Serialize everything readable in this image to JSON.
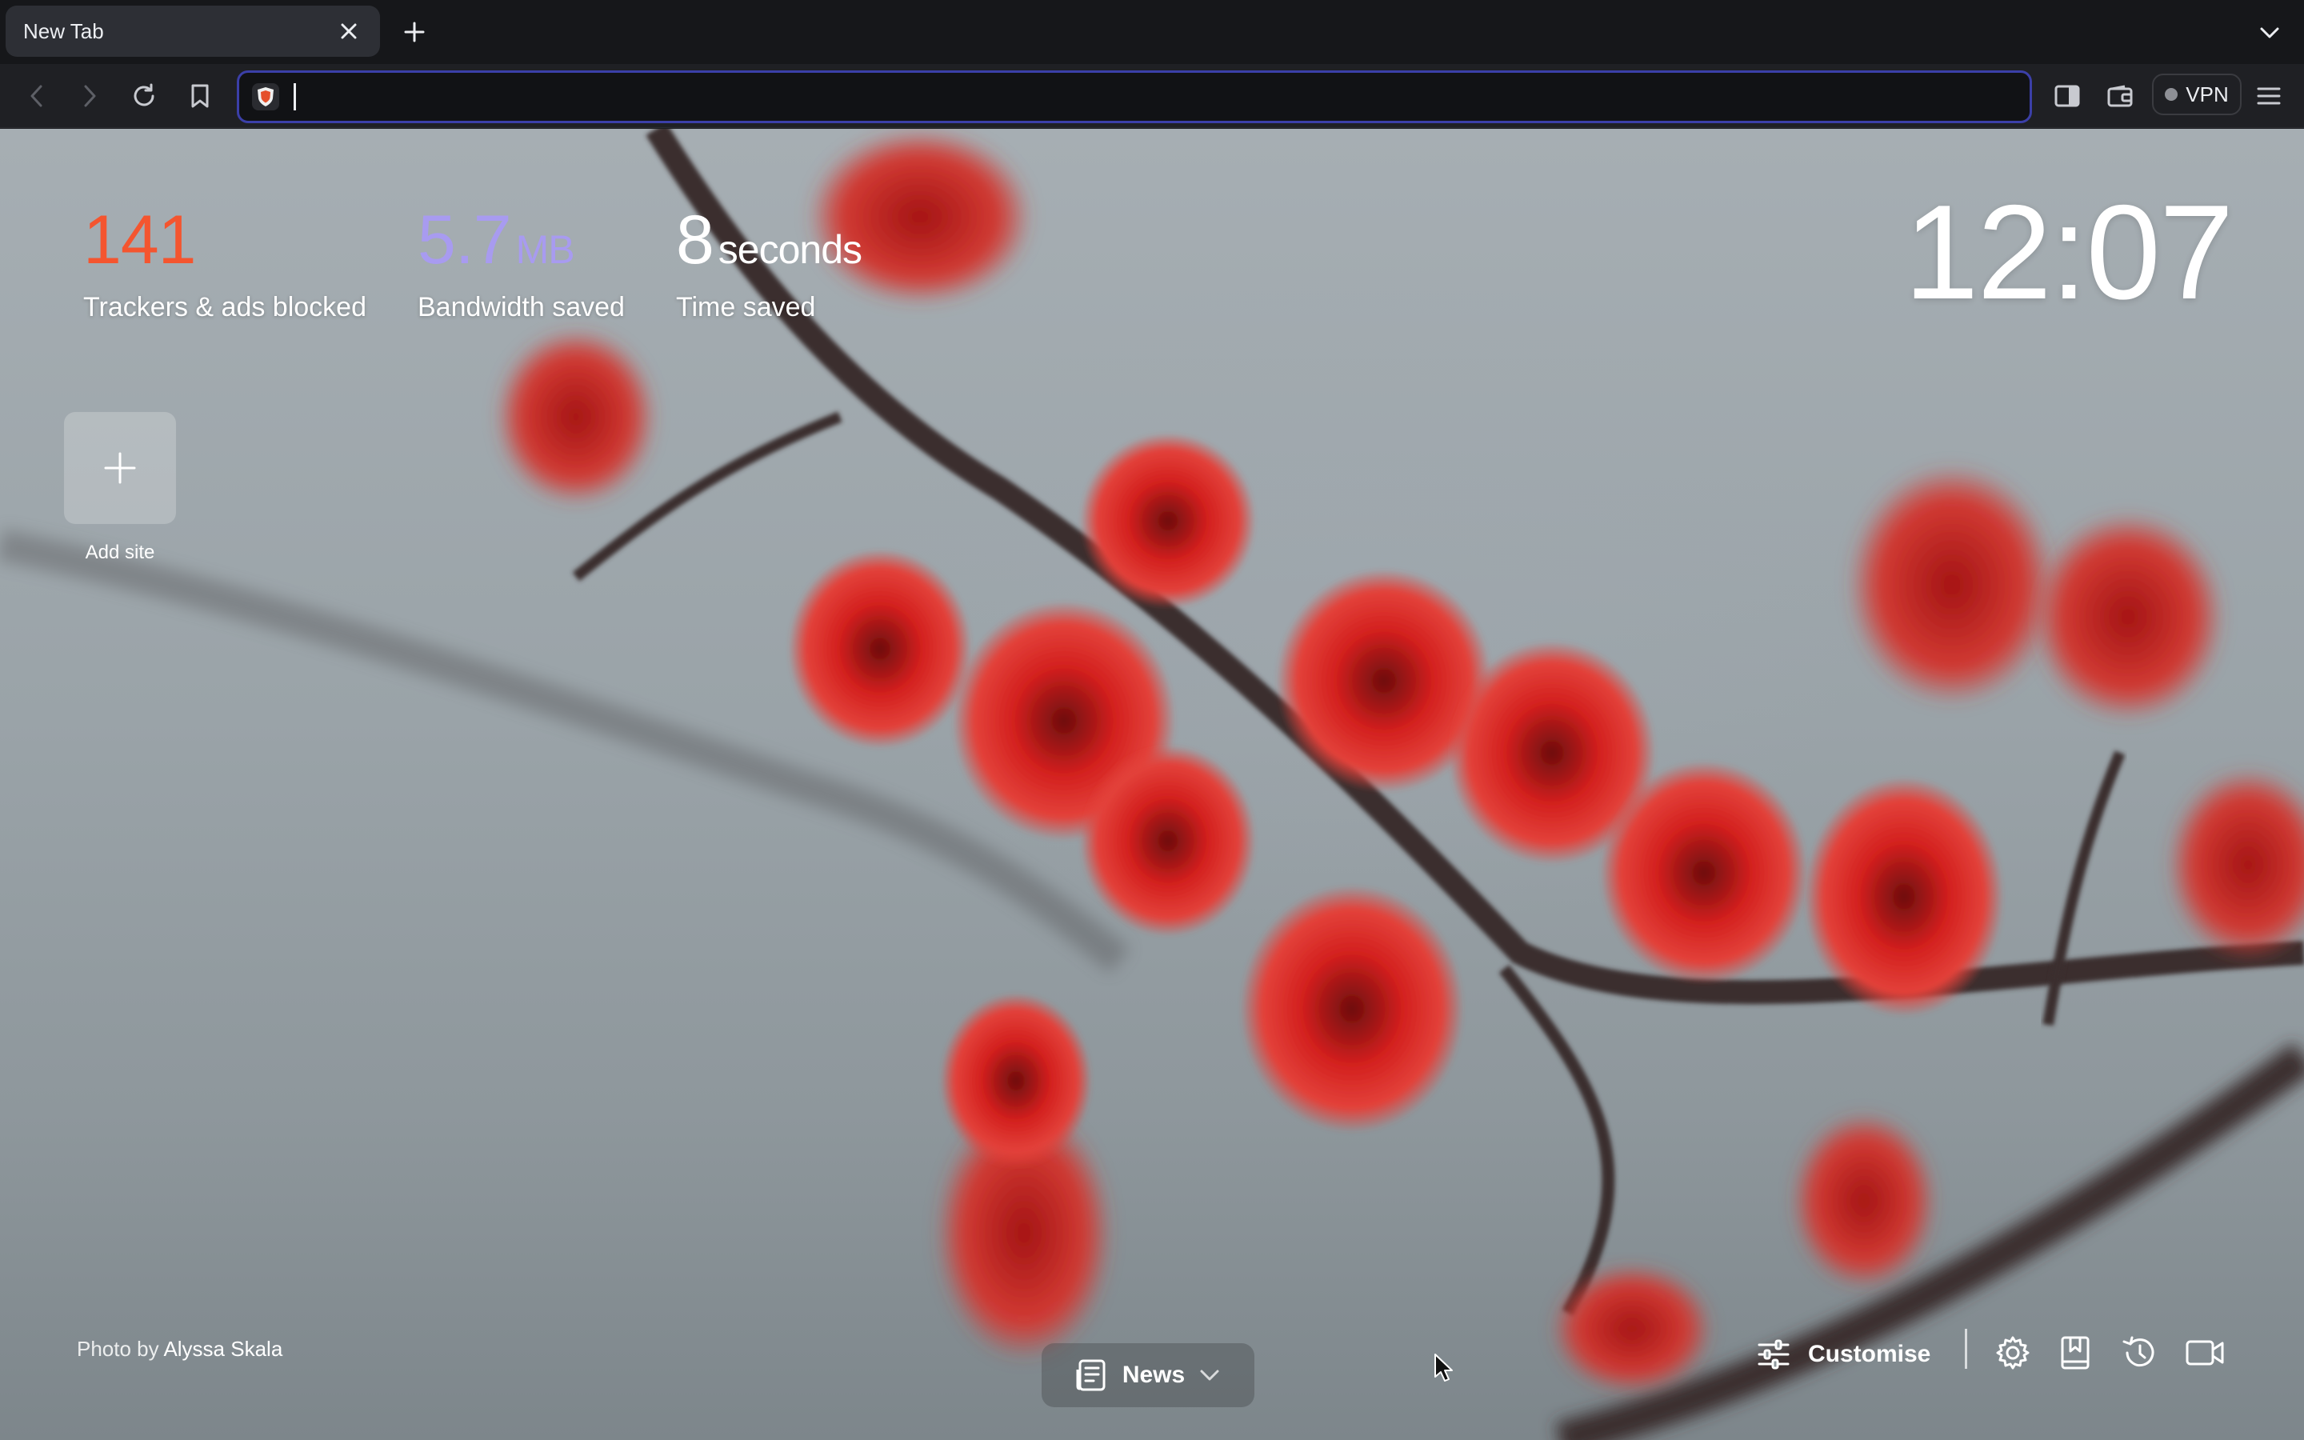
{
  "tab": {
    "title": "New Tab"
  },
  "toolbar": {
    "address_value": "",
    "vpn_label": "VPN"
  },
  "stats": {
    "trackers": {
      "value": "141",
      "label": "Trackers & ads blocked",
      "color": "#f4552f"
    },
    "bandwidth": {
      "value": "5.7",
      "unit": "MB",
      "label": "Bandwidth saved",
      "color": "#a89bf0"
    },
    "time": {
      "value": "8",
      "unit": "seconds",
      "label": "Time saved",
      "color": "#ffffff"
    }
  },
  "clock": {
    "time": "12:07"
  },
  "top_sites": {
    "add_label": "Add site"
  },
  "photo_credit": {
    "prefix": "Photo by",
    "author": "Alyssa Skala"
  },
  "news": {
    "label": "News"
  },
  "customise": {
    "label": "Customise"
  },
  "icons": [
    "close-icon",
    "plus-icon",
    "chevron-down-icon",
    "back-icon",
    "forward-icon",
    "reload-icon",
    "bookmark-icon",
    "brave-shield-icon",
    "sidebar-icon",
    "wallet-icon",
    "menu-icon",
    "news-icon",
    "sliders-icon",
    "gear-icon",
    "bookmarks-icon",
    "history-icon",
    "video-call-icon"
  ]
}
